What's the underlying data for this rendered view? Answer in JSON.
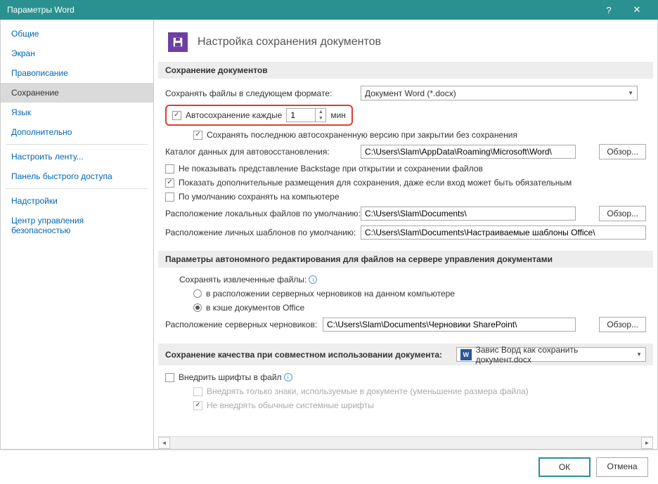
{
  "title": "Параметры Word",
  "sidebar": {
    "items": [
      {
        "label": "Общие"
      },
      {
        "label": "Экран"
      },
      {
        "label": "Правописание"
      },
      {
        "label": "Сохранение",
        "selected": true
      },
      {
        "label": "Язык"
      },
      {
        "label": "Дополнительно"
      },
      {
        "sep": true
      },
      {
        "label": "Настроить ленту..."
      },
      {
        "label": "Панель быстрого доступа"
      },
      {
        "sep": true
      },
      {
        "label": "Надстройки"
      },
      {
        "label": "Центр управления безопасностью"
      }
    ]
  },
  "header": {
    "title": "Настройка сохранения документов"
  },
  "section_save_docs": {
    "header": "Сохранение документов",
    "format_label": "Сохранять файлы в следующем формате:",
    "format_value": "Документ Word (*.docx)",
    "autosave_label": "Автосохранение каждые",
    "autosave_value": "1",
    "autosave_unit": "мин",
    "keep_last_label": "Сохранять последнюю автосохраненную версию при закрытии без сохранения",
    "recovery_label": "Каталог данных для автовосстановления:",
    "recovery_path": "C:\\Users\\Slam\\AppData\\Roaming\\Microsoft\\Word\\",
    "backstage_label": "Не показывать представление Backstage при открытии и сохранении файлов",
    "additional_label": "Показать дополнительные размещения для сохранения, даже если вход может быть обязательным",
    "default_pc_label": "По умолчанию сохранять на компьютере",
    "local_files_label": "Расположение локальных файлов по умолчанию:",
    "local_files_path": "C:\\Users\\Slam\\Documents\\",
    "personal_templates_label": "Расположение личных шаблонов по умолчанию:",
    "personal_templates_path": "C:\\Users\\Slam\\Documents\\Настраиваемые шаблоны Office\\",
    "browse": "Обзор..."
  },
  "section_offline": {
    "header": "Параметры автономного редактирования для файлов на сервере управления документами",
    "save_extracted_label": "Сохранять извлеченные файлы:",
    "radio_server_drafts": "в расположении серверных черновиков на данном компьютере",
    "radio_office_cache": "в кэше документов Office",
    "server_drafts_label": "Расположение серверных черновиков:",
    "server_drafts_path": "C:\\Users\\Slam\\Documents\\Черновики SharePoint\\",
    "browse": "Обзор..."
  },
  "section_quality": {
    "header": "Сохранение качества при совместном использовании документа:",
    "doc_name": "Завис Ворд как сохранить документ.docx",
    "embed_fonts": "Внедрить шрифты в файл",
    "embed_chars_only": "Внедрять только знаки, используемые в документе (уменьшение размера файла)",
    "no_system_fonts": "Не внедрять обычные системные шрифты"
  },
  "buttons": {
    "ok": "ОК",
    "cancel": "Отмена"
  }
}
